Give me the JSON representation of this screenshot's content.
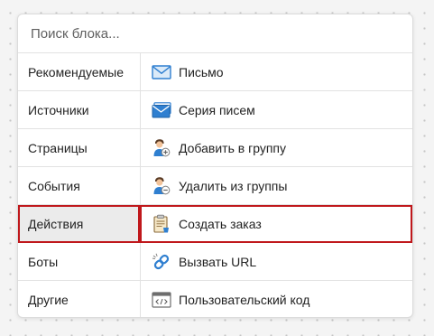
{
  "search": {
    "placeholder": "Поиск блока..."
  },
  "categories": [
    {
      "label": "Рекомендуемые"
    },
    {
      "label": "Источники"
    },
    {
      "label": "Страницы"
    },
    {
      "label": "События"
    },
    {
      "label": "Действия",
      "selected": true
    },
    {
      "label": "Боты"
    },
    {
      "label": "Другие"
    }
  ],
  "items": [
    {
      "label": "Письмо",
      "icon": "envelope-icon"
    },
    {
      "label": "Серия писем",
      "icon": "envelope-series-icon"
    },
    {
      "label": "Добавить в группу",
      "icon": "add-user-icon"
    },
    {
      "label": "Удалить из группы",
      "icon": "remove-user-icon"
    },
    {
      "label": "Создать заказ",
      "icon": "order-clipboard-icon",
      "highlighted": true
    },
    {
      "label": "Вызвать URL",
      "icon": "link-icon"
    },
    {
      "label": "Пользовательский код",
      "icon": "code-window-icon"
    }
  ],
  "colors": {
    "highlight_border": "#c0181c",
    "selected_background": "#ebebeb",
    "icon_blue": "#2f7fd0"
  }
}
